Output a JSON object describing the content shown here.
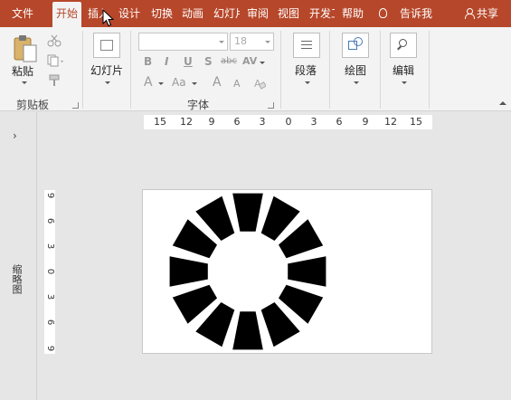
{
  "tabs": [
    {
      "label": "文件",
      "active": false
    },
    {
      "label": "开始",
      "active": true
    },
    {
      "label": "插入",
      "active": false
    },
    {
      "label": "设计",
      "active": false
    },
    {
      "label": "切换",
      "active": false
    },
    {
      "label": "动画",
      "active": false
    },
    {
      "label": "幻灯片放映",
      "active": false
    },
    {
      "label": "审阅",
      "active": false
    },
    {
      "label": "视图",
      "active": false
    },
    {
      "label": "开发工具",
      "active": false
    },
    {
      "label": "帮助",
      "active": false
    }
  ],
  "tell_me": "告诉我",
  "share": "共享",
  "ribbon": {
    "paste_label": "粘贴",
    "clipboard_group": "剪贴板",
    "slide_label": "幻灯片",
    "font_group": "字体",
    "font_size": "18",
    "font_name": "",
    "format_letters": {
      "bold": "B",
      "italic": "I",
      "underline": "U",
      "shadow": "S",
      "strike": "abc",
      "spacing": "AV",
      "font_color": "A",
      "case": "Aa",
      "grow": "A",
      "shrink": "A"
    },
    "paragraph_label": "段落",
    "drawing_label": "绘图",
    "editing_label": "编辑"
  },
  "rail": {
    "chevron": "›",
    "label": "缩略图"
  },
  "ruler": {
    "horizontal": [
      "15",
      "12",
      "9",
      "6",
      "3",
      "0",
      "3",
      "6",
      "9",
      "12",
      "15"
    ],
    "vertical": [
      "9",
      "6",
      "3",
      "0",
      "3",
      "6",
      "9"
    ]
  },
  "colors": {
    "accent": "#b7472a",
    "ribbon_bg": "#f3f3f3",
    "workspace": "#e6e6e6",
    "shape": "#000000"
  }
}
